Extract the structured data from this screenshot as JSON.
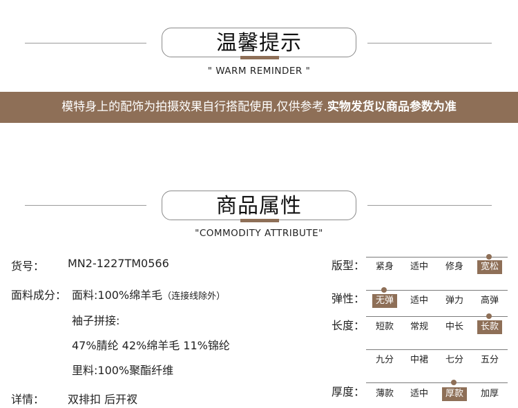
{
  "reminder": {
    "title": "温馨提示",
    "subtitle": "\" WARM REMINDER \"",
    "notice_normal": "模特身上的配饰为拍摄效果自行搭配使用,仅供参考.",
    "notice_bold": "实物发货以商品参数为准"
  },
  "attribute": {
    "title": "商品属性",
    "subtitle": "\"COMMODITY ATTRIBUTE\"",
    "item_no_label": "货号：",
    "item_no_value": "MN2-1227TM0566",
    "fabric_label": "面料成分：",
    "fabric_value": "面料:100%绵羊毛",
    "fabric_note": "（连接线除外）",
    "sleeve_label": "袖子拼接:",
    "sleeve_value": "47%腈纶 42%绵羊毛 11%锦纶",
    "lining_value": "里料:100%聚酯纤维",
    "detail_label": "详情：",
    "detail_value": "双排扣 后开衩"
  },
  "grid": {
    "fit": {
      "label": "版型：",
      "options": [
        "紧身",
        "适中",
        "修身",
        "宽松"
      ],
      "selected": 3
    },
    "elasticity": {
      "label": "弹性：",
      "options": [
        "无弹",
        "适中",
        "弹力",
        "高弹"
      ],
      "selected": 0
    },
    "length": {
      "label": "长度：",
      "options": [
        "短款",
        "常规",
        "中长",
        "长款"
      ],
      "selected": 3
    },
    "length2": {
      "options": [
        "九分",
        "中裙",
        "七分",
        "五分"
      ]
    },
    "thickness": {
      "label": "厚度：",
      "options": [
        "薄款",
        "适中",
        "厚款",
        "加厚"
      ],
      "selected": 2
    }
  }
}
